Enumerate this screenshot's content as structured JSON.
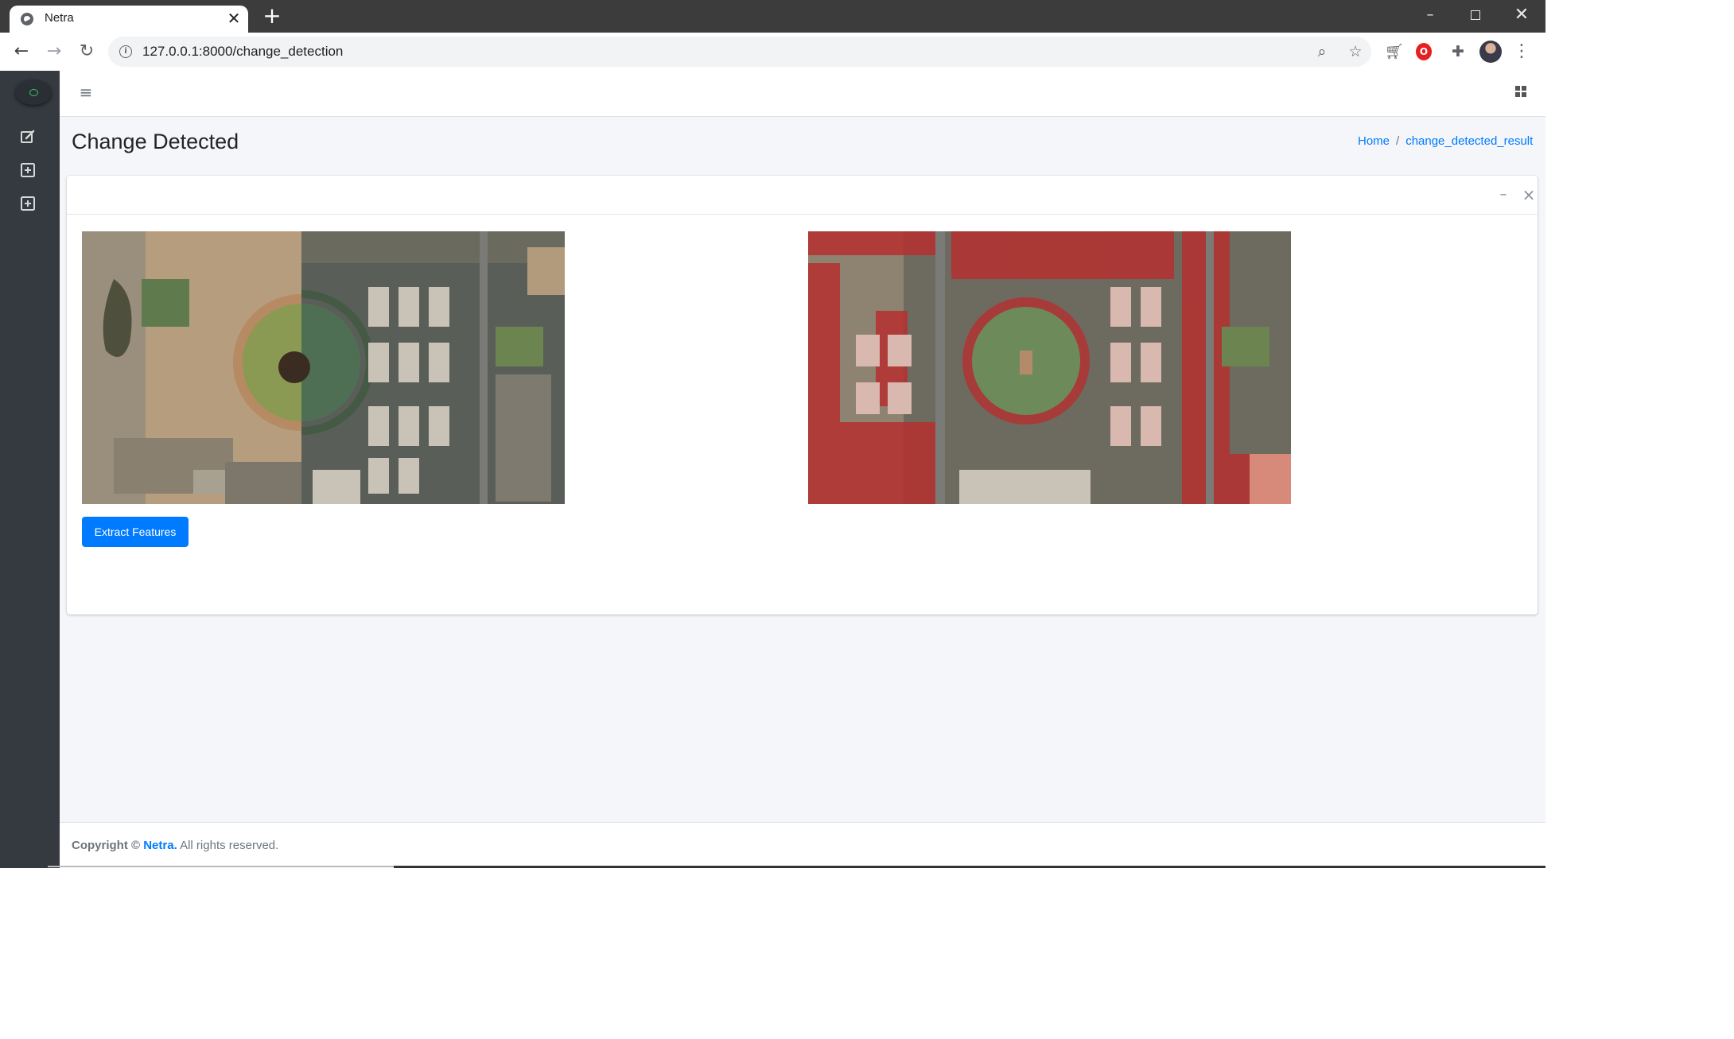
{
  "browser": {
    "tab_title": "Netra",
    "url": "127.0.0.1:8000/change_detection",
    "tab_close_glyph": "✕",
    "new_tab_glyph": "+",
    "icons": [
      "globe-icon",
      "back-icon",
      "forward-icon",
      "reload-icon",
      "info-icon",
      "zoom-icon",
      "star-icon",
      "cart-icon",
      "opera-icon",
      "puzzle-icon",
      "avatar",
      "menu-icon"
    ]
  },
  "sidebar": {
    "items": [
      {
        "icon": "edit-icon"
      },
      {
        "icon": "plus-square-icon"
      },
      {
        "icon": "plus-square-icon"
      }
    ]
  },
  "page": {
    "title": "Change Detected",
    "breadcrumb": {
      "home": "Home",
      "separator": "/",
      "current": "change_detected_result"
    }
  },
  "card": {
    "button_label": "Extract Features",
    "images": [
      {
        "name": "before-image",
        "description_colors": [
          "#b49a7a",
          "#6f8a55",
          "#5a6e66"
        ]
      },
      {
        "name": "change-result-image",
        "highlight_color": "#b5302f"
      }
    ]
  },
  "footer": {
    "copyright": "Copyright ©",
    "brand": "Netra.",
    "rights": "All rights reserved."
  },
  "colors": {
    "sidebar": "#343a40",
    "primary": "#007bff",
    "content_bg": "#f4f6f9",
    "tabbar": "#3c3c3c",
    "change_red": "#b5302f"
  }
}
